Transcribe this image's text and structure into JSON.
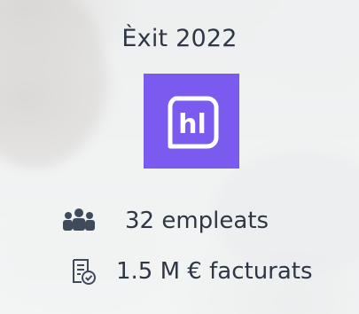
{
  "header": {
    "title": "Èxit 2022"
  },
  "logo": {
    "text": "hl",
    "background_color": "#7b5af0"
  },
  "stats": {
    "employees": {
      "icon": "team-icon",
      "text": "32 empleats"
    },
    "revenue": {
      "icon": "invoice-icon",
      "text": "1.5 M €  facturats"
    }
  },
  "colors": {
    "accent": "#7b5af0",
    "text": "#2f3744",
    "icon": "#3f4a5a"
  }
}
